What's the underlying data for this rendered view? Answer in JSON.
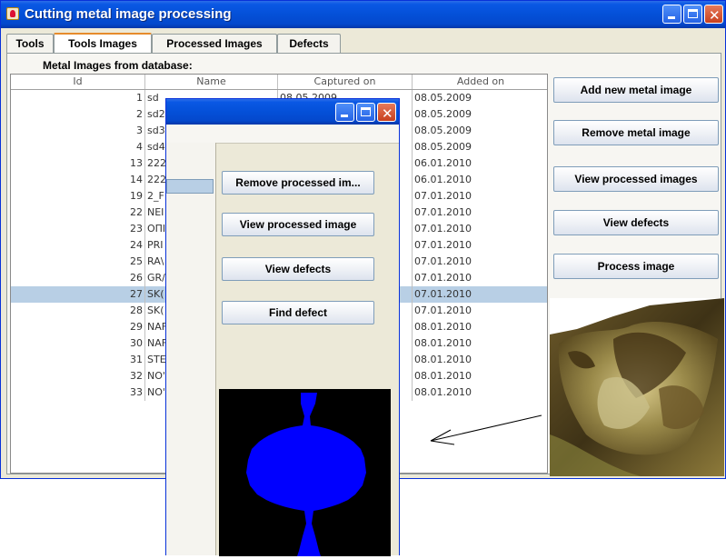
{
  "window": {
    "title": "Cutting metal image processing",
    "tabs": [
      {
        "label": "Tools"
      },
      {
        "label": "Tools Images"
      },
      {
        "label": "Processed Images"
      },
      {
        "label": "Defects"
      }
    ],
    "active_tab": "Tools Images"
  },
  "main": {
    "section_label": "Metal Images from database:",
    "table": {
      "columns": [
        "Id",
        "Name",
        "Captured on",
        "Added on"
      ],
      "rows": [
        {
          "id": "1",
          "name": "sd",
          "captured": "08.05.2009",
          "added": "08.05.2009"
        },
        {
          "id": "2",
          "name": "sd2",
          "captured": "",
          "added": "08.05.2009"
        },
        {
          "id": "3",
          "name": "sd3",
          "captured": "",
          "added": "08.05.2009"
        },
        {
          "id": "4",
          "name": "sd4",
          "captured": "",
          "added": "08.05.2009"
        },
        {
          "id": "13",
          "name": "222",
          "captured": "",
          "added": "06.01.2010"
        },
        {
          "id": "14",
          "name": "222",
          "captured": "",
          "added": "06.01.2010"
        },
        {
          "id": "19",
          "name": "2_F",
          "captured": "",
          "added": "07.01.2010"
        },
        {
          "id": "22",
          "name": "NEI",
          "captured": "",
          "added": "07.01.2010"
        },
        {
          "id": "23",
          "name": "OПI",
          "captured": "",
          "added": "07.01.2010"
        },
        {
          "id": "24",
          "name": "PRI",
          "captured": "",
          "added": "07.01.2010"
        },
        {
          "id": "25",
          "name": "RA\\",
          "captured": "",
          "added": "07.01.2010"
        },
        {
          "id": "26",
          "name": "GR/",
          "captured": "",
          "added": "07.01.2010"
        },
        {
          "id": "27",
          "name": "SK(",
          "captured": "",
          "added": "07.01.2010"
        },
        {
          "id": "28",
          "name": "SK(",
          "captured": "",
          "added": "07.01.2010"
        },
        {
          "id": "29",
          "name": "NAF",
          "captured": "",
          "added": "08.01.2010"
        },
        {
          "id": "30",
          "name": "NAF",
          "captured": "",
          "added": "08.01.2010"
        },
        {
          "id": "31",
          "name": "STE",
          "captured": "",
          "added": "08.01.2010"
        },
        {
          "id": "32",
          "name": "NO'",
          "captured": "",
          "added": "08.01.2010"
        },
        {
          "id": "33",
          "name": "NO'",
          "captured": "",
          "added": "08.01.2010"
        }
      ],
      "selected_id": "27"
    },
    "buttons": {
      "add": "Add new metal image",
      "remove": "Remove metal image",
      "view_processed": "View processed images",
      "view_defects": "View defects",
      "process": "Process image"
    }
  },
  "dialog": {
    "title": "",
    "buttons": {
      "remove_processed": "Remove processed im...",
      "view_processed": "View processed image",
      "view_defects": "View defects",
      "find_defect": "Find defect"
    }
  },
  "colors": {
    "titlebar": "#0450d8",
    "selection": "#b8cfe5",
    "processed_blob": "#0000ff",
    "processed_bg": "#000000"
  }
}
